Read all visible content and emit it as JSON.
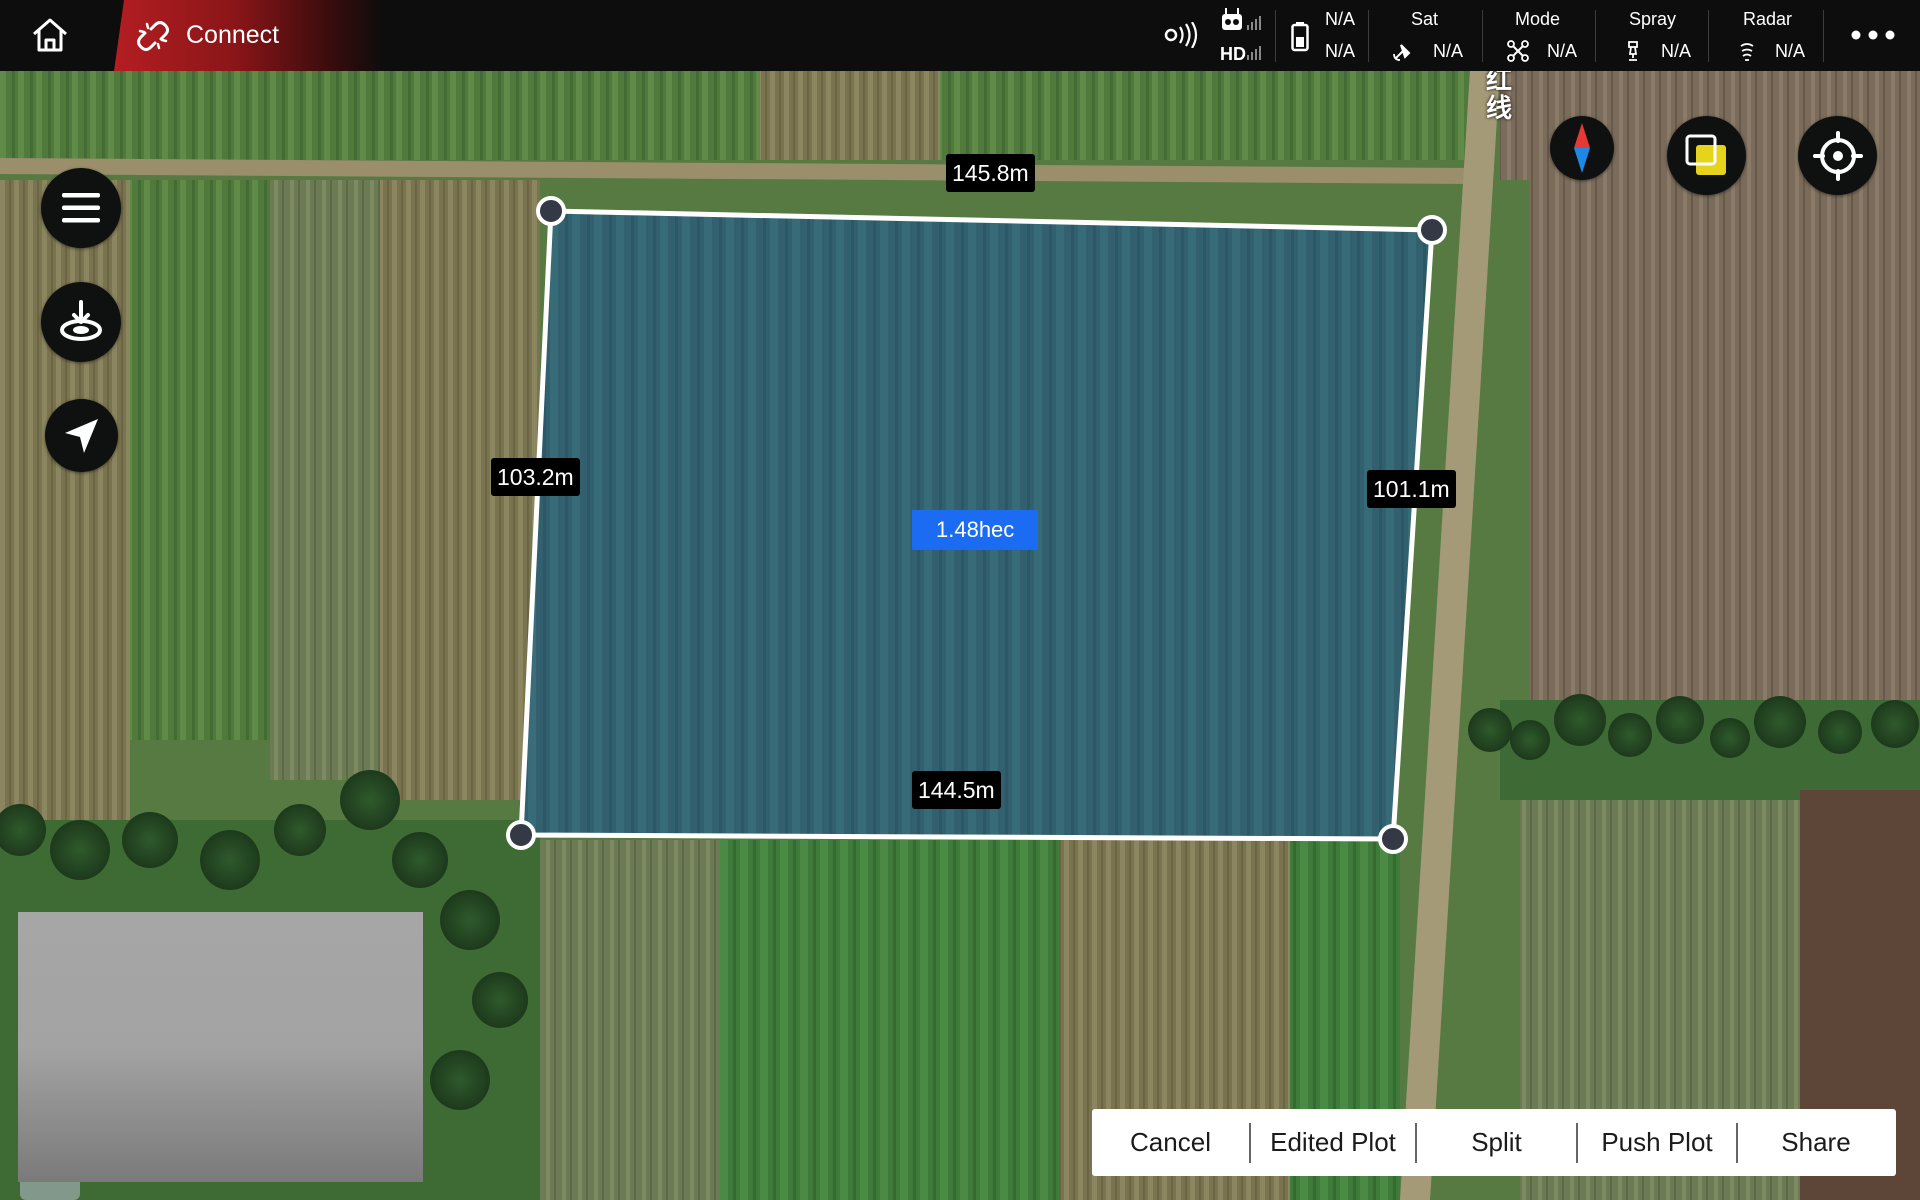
{
  "app": {
    "connect_label": "Connect"
  },
  "status_bar": {
    "rc_label": "HD",
    "battery_top": "N/A",
    "battery_bottom": "N/A",
    "sat": {
      "title": "Sat",
      "value": "N/A"
    },
    "mode": {
      "title": "Mode",
      "value": "N/A"
    },
    "spray": {
      "title": "Spray",
      "value": "N/A"
    },
    "radar": {
      "title": "Radar",
      "value": "N/A"
    }
  },
  "map_overlay_text": "红\n线",
  "plot": {
    "top_edge": "145.8m",
    "bottom_edge": "144.5m",
    "left_edge": "103.2m",
    "right_edge": "101.1m",
    "area": "1.48hec"
  },
  "actions": {
    "cancel": "Cancel",
    "edited_plot": "Edited Plot",
    "split": "Split",
    "push_plot": "Push Plot",
    "share": "Share"
  },
  "colors": {
    "brand_red": "#b31e22",
    "area_badge": "#1b6cf2",
    "plot_fill": "#2e5b73"
  },
  "icons": {
    "home": "home-icon",
    "connect": "broken-link-icon",
    "signal": "signal-icon",
    "rc": "remote-controller-icon",
    "battery": "battery-icon",
    "satellite": "satellite-icon",
    "mode": "drone-icon",
    "spray": "spray-icon",
    "radar": "radar-icon",
    "more": "more-dots-icon",
    "menu": "menu-icon",
    "landing": "landing-pad-icon",
    "navigate": "navigation-arrow-icon",
    "compass": "compass-icon",
    "layers": "layers-icon",
    "locate": "locate-crosshair-icon"
  }
}
